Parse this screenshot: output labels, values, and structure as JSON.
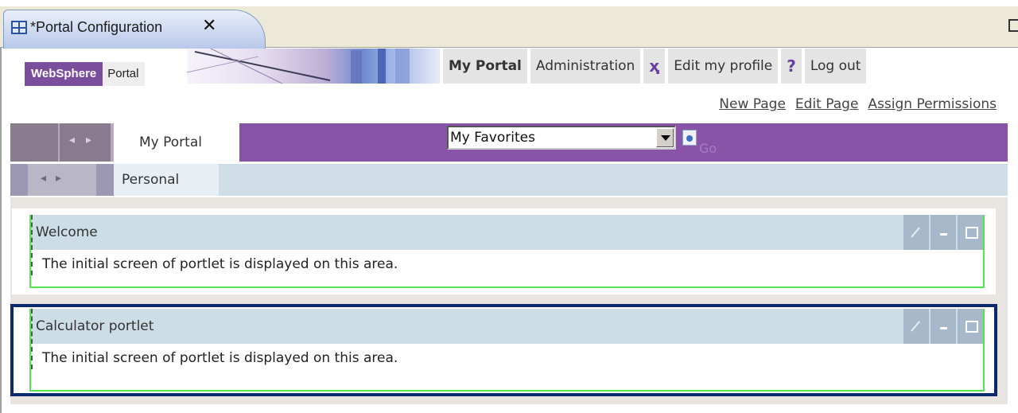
{
  "editor": {
    "tab_title": "*Portal Configuration",
    "close_glyph": "✕"
  },
  "header": {
    "logo_websphere": "WebSphere",
    "logo_portal": "Portal",
    "nav": {
      "my_portal": "My Portal",
      "administration": "Administration",
      "wrench_glyph": "✂",
      "edit_profile": "Edit my profile",
      "help_glyph": "?",
      "logout": "Log out"
    },
    "links": [
      "New Page",
      "Edit Page",
      "Assign Permissions"
    ]
  },
  "pagebar": {
    "active_tab": "My Portal",
    "favorites_value": "My Favorites",
    "go_label": "Go"
  },
  "subbar": {
    "active_tab": "Personal"
  },
  "portlets": [
    {
      "title": "Welcome",
      "body": "The initial screen of portlet is displayed on this area."
    },
    {
      "title": "Calculator portlet",
      "body": "The initial screen of portlet is displayed on this area."
    }
  ],
  "colors": {
    "portal_purple": "#8854a8",
    "titlebar_blue": "#cddde6",
    "selected_border": "#0b2a6e",
    "portlet_outline": "#54e454"
  }
}
